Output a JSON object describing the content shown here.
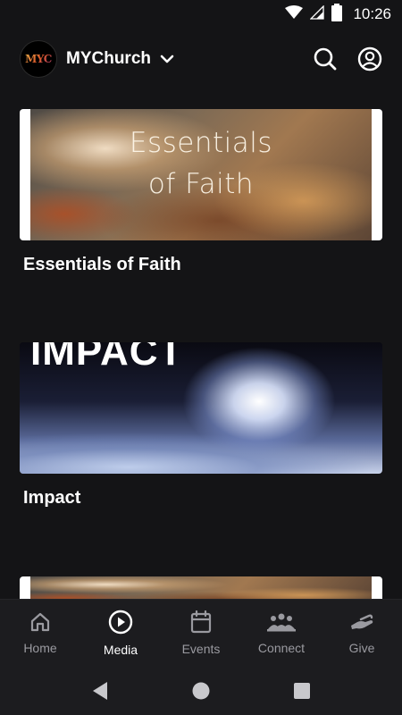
{
  "status_bar": {
    "time": "10:26",
    "icons": [
      "wifi-icon",
      "signal-icon",
      "battery-icon"
    ]
  },
  "header": {
    "logo_text": "MYC",
    "church_name": "MYChurch",
    "icons": [
      "chevron-down-icon",
      "search-icon",
      "account-icon"
    ]
  },
  "media": {
    "items": [
      {
        "title": "Essentials of Faith",
        "thumb_text_line1": "Essentials",
        "thumb_text_line2": "of Faith"
      },
      {
        "title": "Impact",
        "thumb_text": "IMPACT"
      },
      {
        "title": ""
      }
    ]
  },
  "bottom_nav": {
    "items": [
      {
        "label": "Home",
        "icon": "home-icon",
        "active": false
      },
      {
        "label": "Media",
        "icon": "play-circle-icon",
        "active": true
      },
      {
        "label": "Events",
        "icon": "calendar-icon",
        "active": false
      },
      {
        "label": "Connect",
        "icon": "people-group-icon",
        "active": false
      },
      {
        "label": "Give",
        "icon": "give-hand-icon",
        "active": false
      }
    ]
  },
  "colors": {
    "background": "#141416",
    "nav_background": "#1c1c1f",
    "inactive": "#9a9aa0",
    "active": "#ffffff"
  }
}
